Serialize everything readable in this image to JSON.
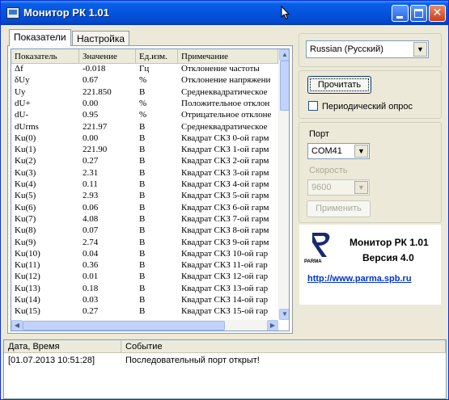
{
  "window": {
    "title": "Монитор РК 1.01"
  },
  "tabs": [
    {
      "label": "Показатели",
      "active": true
    },
    {
      "label": "Настройка",
      "active": false
    }
  ],
  "table": {
    "columns": [
      "Показатель",
      "Значение",
      "Ед.изм.",
      "Примечание"
    ],
    "rows": [
      [
        "Δf",
        "-0.018",
        "Гц",
        "Отклонение частоты"
      ],
      [
        "δUy",
        "0.67",
        "%",
        "Отклонение напряжени"
      ],
      [
        "Uy",
        "221.850",
        "В",
        "Среднеквадратическое"
      ],
      [
        "dU+",
        "0.00",
        "%",
        "Положительное отклон"
      ],
      [
        "dU-",
        "0.95",
        "%",
        "Отрицательное отклоне"
      ],
      [
        "dUrms",
        "221.97",
        "В",
        "Среднеквадратическое"
      ],
      [
        "Ku(0)",
        "0.00",
        "В",
        "Квадрат СКЗ 0-ой гарм"
      ],
      [
        "Ku(1)",
        "221.90",
        "В",
        "Квадрат СКЗ 1-ой гарм"
      ],
      [
        "Ku(2)",
        "0.27",
        "В",
        "Квадрат СКЗ 2-ой гарм"
      ],
      [
        "Ku(3)",
        "2.31",
        "В",
        "Квадрат СКЗ 3-ой гарм"
      ],
      [
        "Ku(4)",
        "0.11",
        "В",
        "Квадрат СКЗ 4-ой гарм"
      ],
      [
        "Ku(5)",
        "2.93",
        "В",
        "Квадрат СКЗ 5-ой гарм"
      ],
      [
        "Ku(6)",
        "0.06",
        "В",
        "Квадрат СКЗ 6-ой гарм"
      ],
      [
        "Ku(7)",
        "4.08",
        "В",
        "Квадрат СКЗ 7-ой гарм"
      ],
      [
        "Ku(8)",
        "0.07",
        "В",
        "Квадрат СКЗ 8-ой гарм"
      ],
      [
        "Ku(9)",
        "2.74",
        "В",
        "Квадрат СКЗ 9-ой гарм"
      ],
      [
        "Ku(10)",
        "0.04",
        "В",
        "Квадрат СКЗ 10-ой гар"
      ],
      [
        "Ku(11)",
        "0.36",
        "В",
        "Квадрат СКЗ 11-ой гар"
      ],
      [
        "Ku(12)",
        "0.01",
        "В",
        "Квадрат СКЗ 12-ой гар"
      ],
      [
        "Ku(13)",
        "0.18",
        "В",
        "Квадрат СКЗ 13-ой гар"
      ],
      [
        "Ku(14)",
        "0.03",
        "В",
        "Квадрат СКЗ 14-ой гар"
      ],
      [
        "Ku(15)",
        "0.27",
        "В",
        "Квадрат СКЗ 15-ой гар"
      ]
    ]
  },
  "settings": {
    "language": "Russian (Русский)",
    "read_button": "Прочитать",
    "periodic_label": "Периодический опрос",
    "port_label": "Порт",
    "port_value": "COM41",
    "speed_label": "Скорость",
    "speed_value": "9600",
    "apply_button": "Применить"
  },
  "about": {
    "logo_text": "PARMA",
    "name": "Монитор РК 1.01",
    "version": "Версия 4.0",
    "link": "http://www.parma.spb.ru",
    "link_color": "#0033cc"
  },
  "log": {
    "columns": [
      "Дата, Время",
      "Событие"
    ],
    "rows": [
      [
        "[01.07.2013 10:51:28]",
        "Последовательный порт открыт!"
      ]
    ]
  },
  "colors": {
    "titlebar": "#0453dd",
    "window_bg": "#ece9d8"
  }
}
